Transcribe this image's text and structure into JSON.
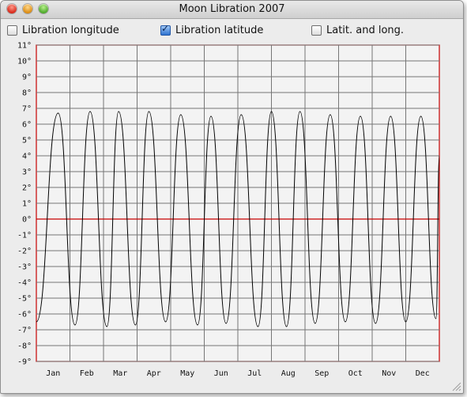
{
  "window": {
    "title": "Moon Libration 2007"
  },
  "controls": {
    "libration_longitude": {
      "label": "Libration longitude",
      "checked": false
    },
    "libration_latitude": {
      "label": "Libration latitude",
      "checked": true
    },
    "latitude_and_longitude": {
      "label": "Latit. and long.",
      "checked": false
    }
  },
  "colors": {
    "curve": "#000000",
    "axis_accent": "#c70000",
    "grid": "#767676",
    "plot_background": "#f3f3f3"
  },
  "chart_data": {
    "type": "line",
    "title": "",
    "xlabel": "",
    "ylabel": "",
    "x_categories": [
      "Jan",
      "Feb",
      "Mar",
      "Apr",
      "May",
      "Jun",
      "Jul",
      "Aug",
      "Sep",
      "Oct",
      "Nov",
      "Dec"
    ],
    "y_ticks": [
      "11°",
      "10°",
      "9°",
      "8°",
      "7°",
      "6°",
      "5°",
      "4°",
      "3°",
      "2°",
      "1°",
      "0°",
      "-1°",
      "-2°",
      "-3°",
      "-4°",
      "-5°",
      "-6°",
      "-7°",
      "-8°",
      "-9°"
    ],
    "ylim": [
      -9,
      11
    ],
    "grid": true,
    "series": [
      {
        "values": [
          -6.5,
          6.7,
          -6.7,
          6.8,
          -6.8,
          6.8,
          -6.7,
          6.8,
          -6.5,
          6.6,
          -6.7,
          6.5,
          -6.6,
          6.6,
          -6.8,
          6.8,
          -6.8,
          6.8,
          -6.6,
          6.6,
          -6.5,
          6.5,
          -6.6,
          6.5,
          -6.5,
          6.5,
          -6.3,
          4.0
        ],
        "x": [
          0,
          0.65,
          1.15,
          1.6,
          2.1,
          2.45,
          2.95,
          3.35,
          3.85,
          4.3,
          4.8,
          5.2,
          5.65,
          6.1,
          6.6,
          7.0,
          7.45,
          7.85,
          8.3,
          8.75,
          9.2,
          9.65,
          10.1,
          10.55,
          11.0,
          11.45,
          11.9,
          12.0
        ]
      }
    ]
  }
}
